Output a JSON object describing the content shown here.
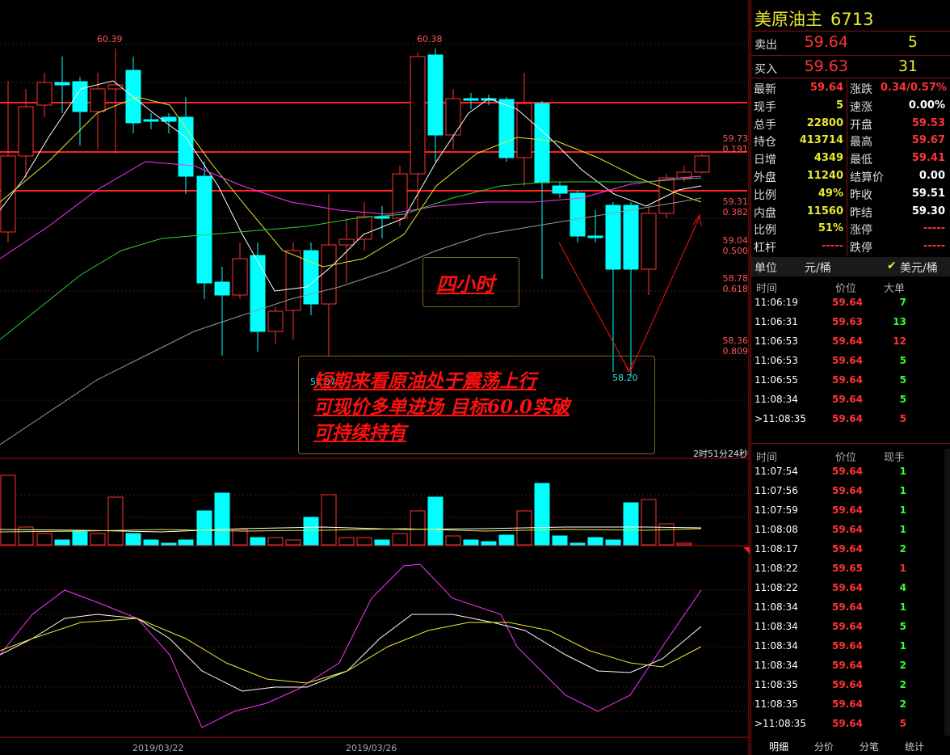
{
  "chart": {
    "high_left": "60.39",
    "high_mid": "60.38",
    "low_left": "58.07",
    "low_right": "58.20",
    "annotation_small": "四小时",
    "annotation_lines": [
      "短期来看原油处于震荡上行",
      "可现价多单进场  目标60.0实破",
      "可持续持有"
    ],
    "timer": "2时51分24秒",
    "dates": [
      "2019/03/22",
      "2019/03/26"
    ],
    "fib_levels": [
      {
        "price": "59.73",
        "ratio": "0.191"
      },
      {
        "price": "59.31",
        "ratio": "0.382"
      },
      {
        "price": "59.04",
        "ratio": "0.500"
      },
      {
        "price": "58.78",
        "ratio": "0.618"
      },
      {
        "price": "58.36",
        "ratio": "0.809"
      }
    ],
    "colors": {
      "up": "#ff3333",
      "down": "#00ffff",
      "ma_white": "#ffffff",
      "ma_yellow": "#e8e830",
      "ma_magenta": "#ff33ff",
      "ma_green": "#33cc33",
      "ma_gray": "#999999"
    }
  },
  "panel": {
    "name": "美原油主",
    "code": "6713",
    "sell_label": "卖出",
    "sell_price": "59.64",
    "sell_qty": "5",
    "buy_label": "买入",
    "buy_price": "59.63",
    "buy_qty": "31",
    "stats": [
      {
        "l1": "最新",
        "v1": "59.64",
        "c1": "red",
        "l2": "涨跌",
        "v2": "0.34/0.57%",
        "c2": "red"
      },
      {
        "l1": "现手",
        "v1": "5",
        "c1": "yel",
        "l2": "速涨",
        "v2": "0.00%",
        "c2": "wht"
      },
      {
        "l1": "总手",
        "v1": "22800",
        "c1": "yel",
        "l2": "开盘",
        "v2": "59.53",
        "c2": "red"
      },
      {
        "l1": "持仓",
        "v1": "413714",
        "c1": "yel",
        "l2": "最高",
        "v2": "59.67",
        "c2": "red"
      },
      {
        "l1": "日增",
        "v1": "4349",
        "c1": "yel",
        "l2": "最低",
        "v2": "59.41",
        "c2": "red"
      },
      {
        "l1": "外盘",
        "v1": "11240",
        "c1": "yel",
        "l2": "结算价",
        "v2": "0.00",
        "c2": "wht"
      },
      {
        "l1": "比例",
        "v1": "49%",
        "c1": "yel",
        "l2": "昨收",
        "v2": "59.51",
        "c2": "wht"
      },
      {
        "l1": "内盘",
        "v1": "11560",
        "c1": "yel",
        "l2": "昨结",
        "v2": "59.30",
        "c2": "wht"
      },
      {
        "l1": "比例",
        "v1": "51%",
        "c1": "yel",
        "l2": "涨停",
        "v2": "-----",
        "c2": "red"
      },
      {
        "l1": "杠杆",
        "v1": "-----",
        "c1": "red",
        "l2": "跌停",
        "v2": "-----",
        "c2": "red"
      }
    ],
    "unit_label": "单位",
    "unit_opt1": "元/桶",
    "unit_opt2": "美元/桶",
    "big_header": {
      "time": "时间",
      "price": "价位",
      "qty": "大单"
    },
    "big_orders": [
      {
        "time": "11:06:19",
        "price": "59.64",
        "qty": "7",
        "c": "grn"
      },
      {
        "time": "11:06:31",
        "price": "59.63",
        "qty": "13",
        "c": "grn"
      },
      {
        "time": "11:06:53",
        "price": "59.64",
        "qty": "12",
        "c": "red"
      },
      {
        "time": "11:06:53",
        "price": "59.64",
        "qty": "5",
        "c": "grn"
      },
      {
        "time": "11:06:55",
        "price": "59.64",
        "qty": "5",
        "c": "grn"
      },
      {
        "time": "11:08:34",
        "price": "59.64",
        "qty": "5",
        "c": "grn"
      },
      {
        "time": ">11:08:35",
        "price": "59.64",
        "qty": "5",
        "c": "red"
      }
    ],
    "tick_header": {
      "time": "时间",
      "price": "价位",
      "qty": "现手"
    },
    "ticks": [
      {
        "time": "11:07:54",
        "price": "59.64",
        "qty": "1",
        "c": "grn"
      },
      {
        "time": "11:07:56",
        "price": "59.64",
        "qty": "1",
        "c": "grn"
      },
      {
        "time": "11:07:59",
        "price": "59.64",
        "qty": "1",
        "c": "grn"
      },
      {
        "time": "11:08:08",
        "price": "59.64",
        "qty": "1",
        "c": "grn"
      },
      {
        "time": "11:08:17",
        "price": "59.64",
        "qty": "2",
        "c": "grn"
      },
      {
        "time": "11:08:22",
        "price": "59.65",
        "qty": "1",
        "c": "red"
      },
      {
        "time": "11:08:22",
        "price": "59.64",
        "qty": "4",
        "c": "grn"
      },
      {
        "time": "11:08:34",
        "price": "59.64",
        "qty": "1",
        "c": "grn"
      },
      {
        "time": "11:08:34",
        "price": "59.64",
        "qty": "5",
        "c": "grn"
      },
      {
        "time": "11:08:34",
        "price": "59.64",
        "qty": "1",
        "c": "grn"
      },
      {
        "time": "11:08:34",
        "price": "59.64",
        "qty": "2",
        "c": "grn"
      },
      {
        "time": "11:08:35",
        "price": "59.64",
        "qty": "2",
        "c": "grn"
      },
      {
        "time": "11:08:35",
        "price": "59.64",
        "qty": "2",
        "c": "grn"
      },
      {
        "time": ">11:08:35",
        "price": "59.64",
        "qty": "5",
        "c": "red"
      }
    ],
    "tabs": [
      "明细",
      "分价",
      "分笔",
      "统计"
    ]
  }
}
